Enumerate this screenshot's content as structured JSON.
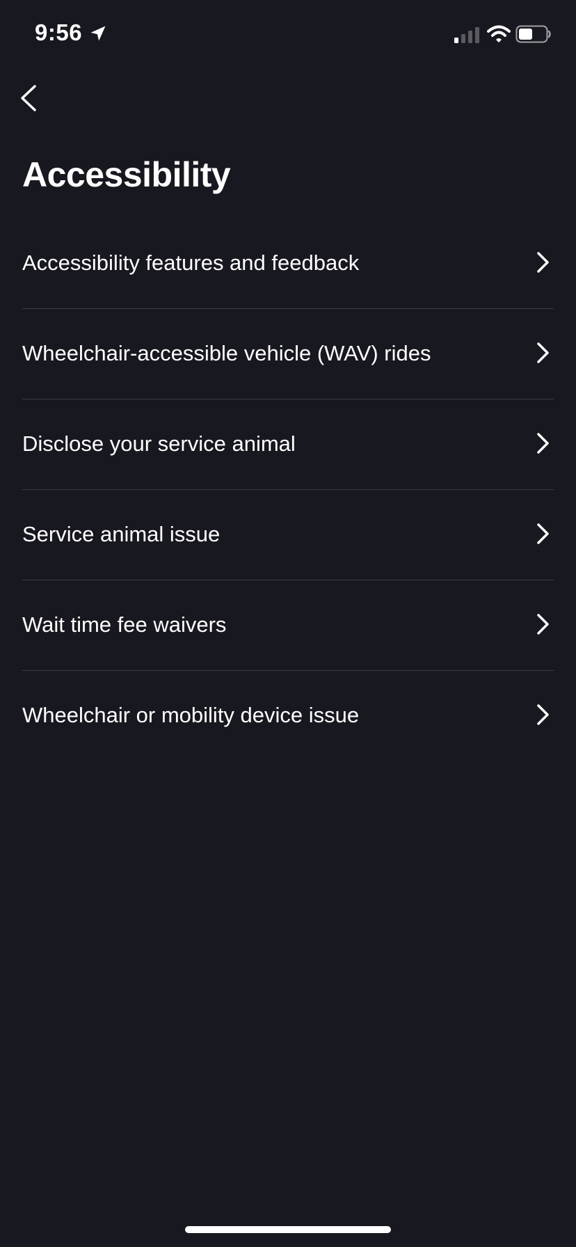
{
  "status_bar": {
    "time": "9:56"
  },
  "header": {
    "title": "Accessibility"
  },
  "menu": {
    "items": [
      {
        "label": "Accessibility features and feedback"
      },
      {
        "label": "Wheelchair-accessible vehicle (WAV) rides"
      },
      {
        "label": "Disclose your service animal"
      },
      {
        "label": "Service animal issue"
      },
      {
        "label": "Wait time fee waivers"
      },
      {
        "label": "Wheelchair or mobility device issue"
      }
    ]
  },
  "icons": {
    "back": "chevron-left-icon",
    "row_chevron": "chevron-right-icon",
    "status": [
      "location-arrow-icon",
      "cellular-signal-icon",
      "wifi-icon",
      "battery-icon"
    ]
  },
  "colors": {
    "background": "#181820",
    "text": "#ffffff",
    "divider": "#3d3d46"
  }
}
